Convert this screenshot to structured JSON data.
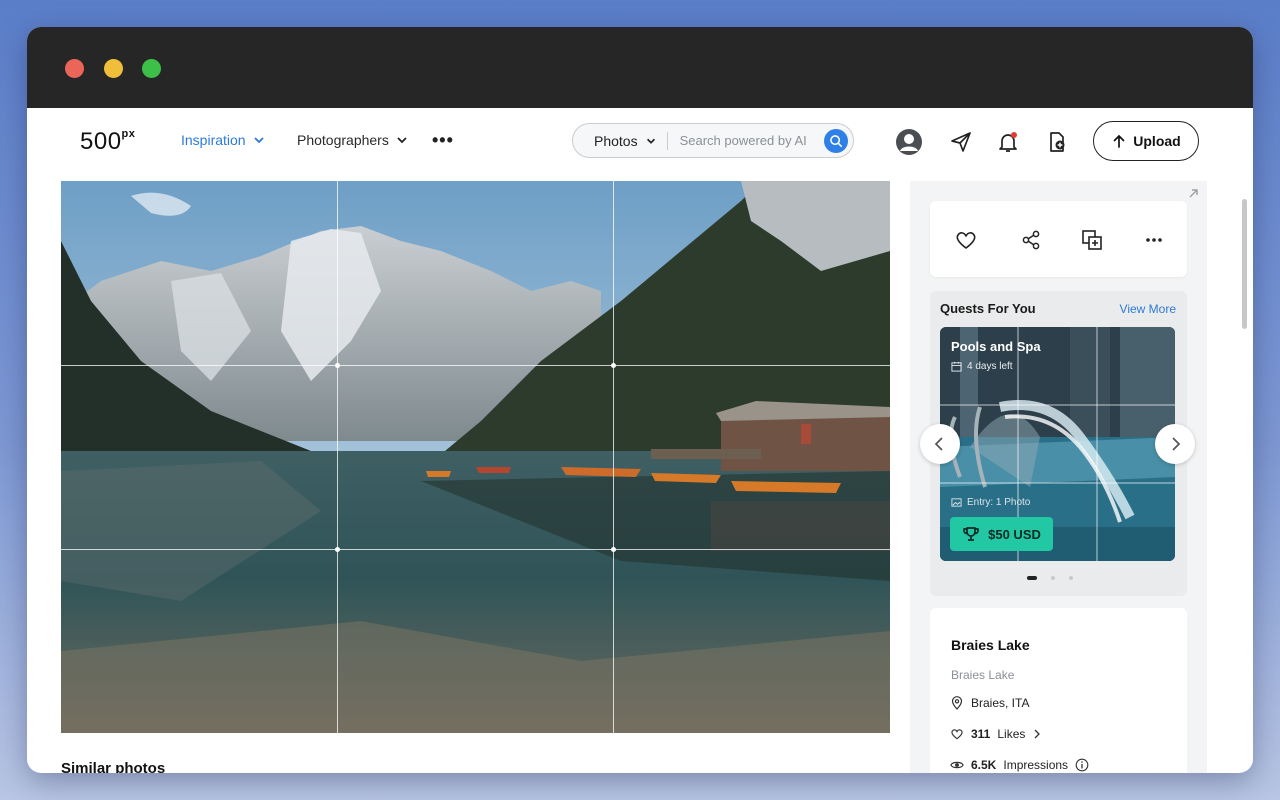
{
  "window": {
    "controls": [
      "close",
      "minimize",
      "maximize"
    ]
  },
  "header": {
    "logo": "500",
    "logo_sup": "px",
    "nav": [
      {
        "label": "Inspiration",
        "active": true
      },
      {
        "label": "Photographers",
        "active": false
      }
    ],
    "more": "•••",
    "search": {
      "category": "Photos",
      "placeholder": "Search powered by AI"
    },
    "icons": [
      "user-avatar-icon",
      "send-icon",
      "bell-icon",
      "add-to-gallery-icon"
    ],
    "upload_label": "Upload"
  },
  "photo": {
    "location": "Braies Lake",
    "grid_overlay": "rule-of-thirds"
  },
  "similar": {
    "title": "Similar photos"
  },
  "actions": [
    "heart-icon",
    "share-icon",
    "add-to-gallery-icon",
    "more-icon"
  ],
  "quests": {
    "title": "Quests For You",
    "view_more": "View More",
    "current": {
      "name": "Pools and Spa",
      "days_left": "4 days left",
      "entry": "Entry: 1 Photo",
      "prize": "$50 USD"
    },
    "pages": 3,
    "active_page": 1
  },
  "info": {
    "title": "Braies Lake",
    "subtitle": "Braies Lake",
    "location": "Braies, ITA",
    "likes_count": "311",
    "likes_label": "Likes",
    "impressions_count": "6.5K",
    "impressions_label": "Impressions"
  },
  "colors": {
    "accent": "#2e7bd6",
    "search_button": "#2f80e6",
    "prize_badge": "#22c7a4",
    "titlebar": "#262626",
    "notification_dot": "#e53935"
  }
}
